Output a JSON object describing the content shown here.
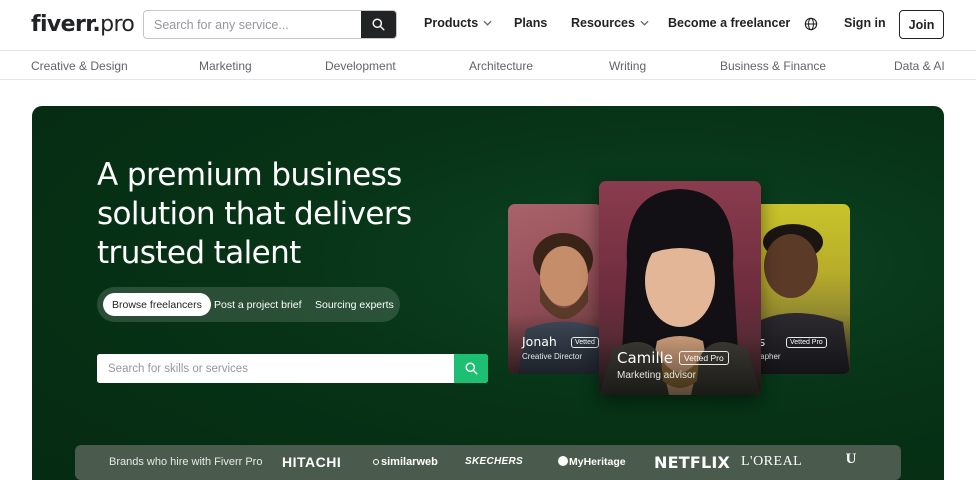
{
  "header": {
    "logo_text": "fiverr",
    "logo_dot": ".",
    "logo_suffix": "pro",
    "search_placeholder": "Search for any service...",
    "nav": {
      "products": "Products",
      "plans": "Plans",
      "resources": "Resources",
      "become_freelancer": "Become a freelancer",
      "sign_in": "Sign in",
      "join": "Join"
    }
  },
  "categories": [
    "Creative & Design",
    "Marketing",
    "Development",
    "Architecture",
    "Writing",
    "Business & Finance",
    "Data & AI"
  ],
  "hero": {
    "headline_lines": [
      "A premium business",
      "solution that delivers",
      "trusted talent"
    ],
    "segments": {
      "browse": "Browse freelancers",
      "post": "Post a project brief",
      "sourcing": "Sourcing experts"
    },
    "search_placeholder": "Search for skills or services",
    "cards": {
      "left": {
        "name": "Jonah",
        "role": "Creative Director",
        "badge": "Vetted"
      },
      "center": {
        "name": "Camille",
        "role": "Marketing advisor",
        "badge": "Vetted Pro"
      },
      "right": {
        "name": "es",
        "role": "grapher",
        "badge": "Vetted Pro"
      }
    }
  },
  "brands": {
    "label": "Brands who hire with Fiverr Pro",
    "logos": [
      "HITACHI",
      "similarweb",
      "SKECHERS",
      "MyHeritage",
      "NETFLIX",
      "L'OREAL",
      "U"
    ]
  },
  "colors": {
    "hero_green": "#073316",
    "accent_green": "#1dbf73",
    "dark": "#222325"
  },
  "icons": {
    "search": "search-icon",
    "chevron": "chevron-down-icon",
    "globe": "globe-icon"
  }
}
